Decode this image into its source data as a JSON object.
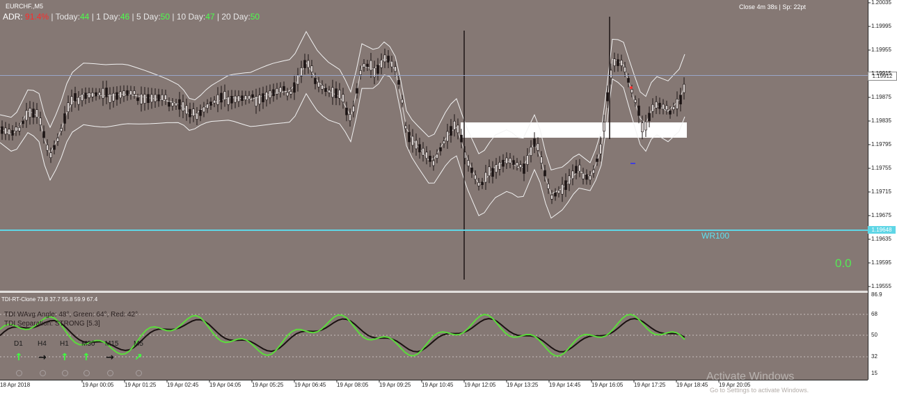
{
  "header": {
    "symbol": "EURCHF.,M5",
    "adr": {
      "adr_label": "ADR:",
      "adr_value": "91.4%",
      "today_label": "| Today:",
      "today_value": "44",
      "day1_label": "| 1 Day:",
      "day1_value": "46",
      "day5_label": "| 5 Day:",
      "day5_value": "50",
      "day10_label": "| 10 Day:",
      "day10_value": "47",
      "day20_label": "|   20 Day:",
      "day20_value": "50"
    },
    "close_info": "Close 4m 38s | Sp: 22pt"
  },
  "main_chart": {
    "price_labels": [
      "1.20035",
      "1.19995",
      "1.19955",
      "1.19915",
      "1.19875",
      "1.19835",
      "1.19795",
      "1.19755",
      "1.19715",
      "1.19675",
      "1.19635",
      "1.19595",
      "1.19555"
    ],
    "current_price": "1.19912",
    "wr_price": "1.19648",
    "wr_label": "WR100",
    "signal_value": "0.0",
    "colors": {
      "background": "#857874",
      "candle": "#1c1414",
      "bands": "#f2f2f2",
      "wr_line": "#5fd6e6",
      "current_line": "#9aa7c9",
      "zone": "#ffffff"
    }
  },
  "tdi": {
    "title": "TDI-RT-Clone 73.8 37.7 55.8 59.9 67.4",
    "wave_angle": "TDI WAvg Angle: 48°, Green: 64°, Red: 42°",
    "separation": "TDI Separation: STRONG [5.3]",
    "levels": [
      "86.9",
      "68",
      "50",
      "32",
      "15"
    ],
    "timeframes": [
      {
        "label": "D1",
        "arrow": "up",
        "color": "#3dff3d"
      },
      {
        "label": "H4",
        "arrow": "right",
        "color": "#111111"
      },
      {
        "label": "H1",
        "arrow": "up",
        "color": "#3dff3d"
      },
      {
        "label": "M30",
        "arrow": "up",
        "color": "#3dff3d"
      },
      {
        "label": "M15",
        "arrow": "right",
        "color": "#111111"
      },
      {
        "label": "M5",
        "arrow": "up-right",
        "color": "#3dff3d"
      }
    ],
    "colors": {
      "green_line": "#5cdc3c",
      "red_line": "#1a1111"
    }
  },
  "time_labels": [
    "18 Apr 2018",
    "19 Apr 00:05",
    "19 Apr 01:25",
    "19 Apr 02:45",
    "19 Apr 04:05",
    "19 Apr 05:25",
    "19 Apr 06:45",
    "19 Apr 08:05",
    "19 Apr 09:25",
    "19 Apr 10:45",
    "19 Apr 12:05",
    "19 Apr 13:25",
    "19 Apr 14:45",
    "19 Apr 16:05",
    "19 Apr 17:25",
    "19 Apr 18:45",
    "19 Apr 20:05"
  ],
  "watermark": {
    "title": "Activate Windows",
    "subtitle": "Go to Settings to activate Windows."
  }
}
